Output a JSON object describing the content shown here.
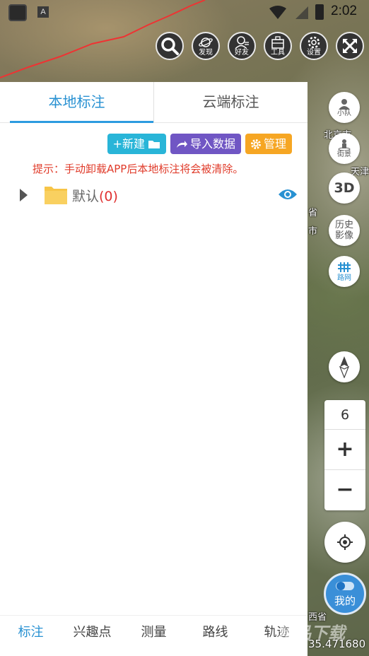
{
  "status_bar": {
    "time": "2:02",
    "a_badge": "A"
  },
  "top_buttons": [
    {
      "label": "",
      "icon": "search-icon"
    },
    {
      "label": "发现",
      "icon": "planet-icon"
    },
    {
      "label": "好友",
      "icon": "person-icon"
    },
    {
      "label": "工具",
      "icon": "toolbox-icon"
    },
    {
      "label": "设置",
      "icon": "gear-icon"
    },
    {
      "label": "",
      "icon": "fullscreen-icon"
    }
  ],
  "panel": {
    "tabs": [
      {
        "label": "本地标注",
        "active": true
      },
      {
        "label": "云端标注",
        "active": false
      }
    ],
    "actions": {
      "new": "+新建",
      "import": "导入数据",
      "manage": "管理"
    },
    "tip": "提示：手动卸载APP后本地标注将会被清除。",
    "folders": [
      {
        "name": "默认",
        "count": "(0)"
      }
    ]
  },
  "bottom_nav": [
    "标注",
    "兴趣点",
    "测量",
    "路线",
    "轨迹"
  ],
  "right_controls": {
    "team": "小队",
    "street": "街景",
    "three_d": "3D",
    "history_1": "历史",
    "history_2": "影像",
    "roadnet": "路网",
    "zoom_level": "6",
    "zoom_in": "+",
    "zoom_out": "−",
    "mine": "我的"
  },
  "map_labels": {
    "beijing": "北京市",
    "tianjin": "天津",
    "sheng": "省",
    "shi": "市",
    "xisheng": "西省",
    "coord": "35.471680"
  },
  "watermark": "精品下载",
  "colors": {
    "accent": "#2891d2",
    "tip_red": "#e03b2a",
    "new_btn": "#29b5d8",
    "import_btn": "#7056c4",
    "manage_btn": "#f6a623"
  }
}
